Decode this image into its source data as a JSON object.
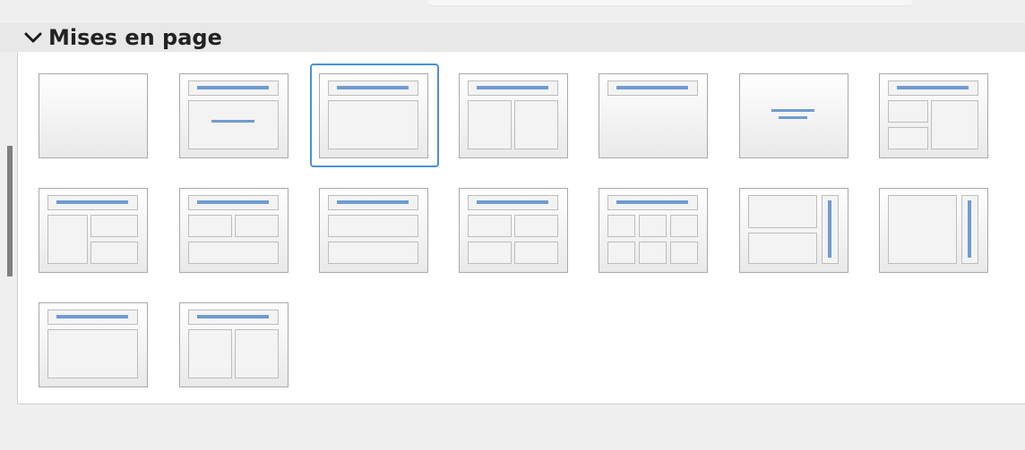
{
  "section": {
    "title": "Mises en page",
    "collapse_icon": "chevron-down-icon",
    "expanded": true
  },
  "layouts": [
    {
      "name": "blank",
      "selected": false
    },
    {
      "name": "title-content-centered",
      "selected": false
    },
    {
      "name": "title-content",
      "selected": true
    },
    {
      "name": "title-two-content",
      "selected": false
    },
    {
      "name": "title-only",
      "selected": false
    },
    {
      "name": "centered-text",
      "selected": false
    },
    {
      "name": "title-two-left-one-right",
      "selected": false
    },
    {
      "name": "title-one-left-two-right",
      "selected": false
    },
    {
      "name": "title-two-top-one-bottom",
      "selected": false
    },
    {
      "name": "title-content-over-content",
      "selected": false
    },
    {
      "name": "title-four-content",
      "selected": false
    },
    {
      "name": "title-six-content",
      "selected": false
    },
    {
      "name": "vertical-title-two-content",
      "selected": false
    },
    {
      "name": "vertical-title-content",
      "selected": false
    },
    {
      "name": "title-content-2",
      "selected": false
    },
    {
      "name": "title-two-content-2",
      "selected": false
    }
  ],
  "colors": {
    "accent": "#4a90d9",
    "bar": "#6f9bd1",
    "tile_border": "#a9a9a9",
    "box_border": "#bdbdbd"
  }
}
